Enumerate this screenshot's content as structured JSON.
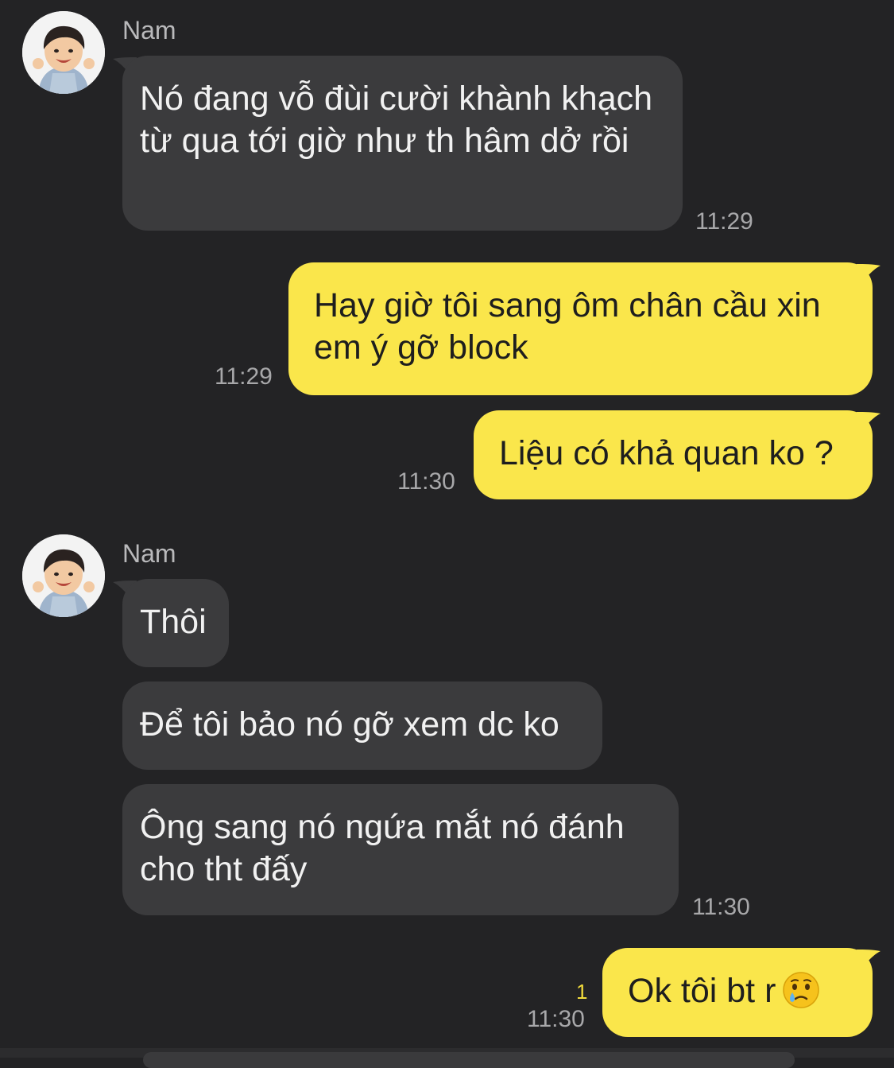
{
  "chat": {
    "contact_name": "Nam",
    "avatar_icon": "child-avatar",
    "messages": [
      {
        "text": "Nó đang vỗ đùi cười khành khạch từ qua tới giờ như th hâm dở rồi",
        "time": "11:29"
      },
      {
        "text": "Hay giờ tôi sang ôm chân cầu xin em ý gỡ block",
        "time": "11:29"
      },
      {
        "text": "Liệu có khả quan ko ?",
        "time": "11:30"
      },
      {
        "text": "Thôi"
      },
      {
        "text": "Để tôi bảo nó gỡ xem dc ko"
      },
      {
        "text": "Ông sang nó ngứa mắt nó đánh cho tht đấy",
        "time": "11:30"
      },
      {
        "text": "Ok tôi bt r",
        "emoji": "crying-face-emoji",
        "time": "11:30",
        "unread": "1"
      }
    ]
  },
  "colors": {
    "background": "#232325",
    "incoming_bubble": "#3b3b3d",
    "outgoing_bubble": "#fae64b"
  }
}
